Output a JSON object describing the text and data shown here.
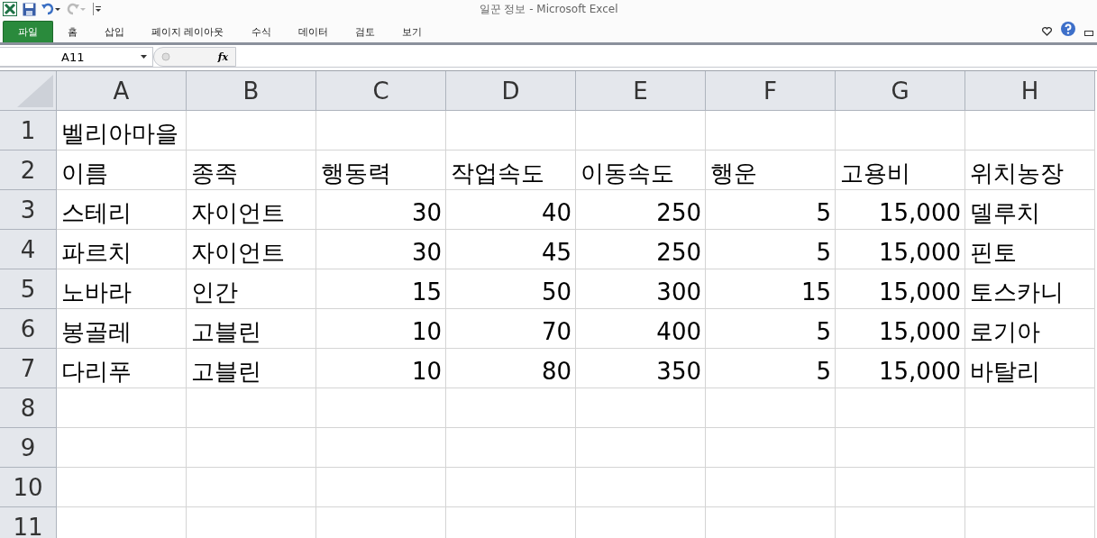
{
  "window": {
    "title": "일꾼 정보  -  Microsoft Excel"
  },
  "ribbon_tabs": [
    {
      "label": "파일",
      "kind": "file",
      "selected": false
    },
    {
      "label": "홈",
      "kind": "tab",
      "selected": false
    },
    {
      "label": "삽입",
      "kind": "tab",
      "selected": false
    },
    {
      "label": "페이지 레이아웃",
      "kind": "tab",
      "selected": false
    },
    {
      "label": "수식",
      "kind": "tab",
      "selected": false
    },
    {
      "label": "데이터",
      "kind": "tab",
      "selected": false
    },
    {
      "label": "검토",
      "kind": "tab",
      "selected": false
    },
    {
      "label": "보기",
      "kind": "tab",
      "selected": false
    }
  ],
  "formula_bar": {
    "name_box": "A11",
    "fx": "fx"
  },
  "sheet": {
    "columns": [
      "A",
      "B",
      "C",
      "D",
      "E",
      "F",
      "G",
      "H"
    ],
    "rows": [
      {
        "header": "1",
        "cells": [
          {
            "text": "벨리아마을",
            "kind": "text"
          },
          null,
          null,
          null,
          null,
          null,
          null,
          null
        ]
      },
      {
        "header": "2",
        "cells": [
          {
            "text": "이름",
            "kind": "text"
          },
          {
            "text": "종족",
            "kind": "text"
          },
          {
            "text": "행동력",
            "kind": "text"
          },
          {
            "text": "작업속도",
            "kind": "text"
          },
          {
            "text": "이동속도",
            "kind": "text"
          },
          {
            "text": "행운",
            "kind": "text"
          },
          {
            "text": "고용비",
            "kind": "text"
          },
          {
            "text": "위치농장",
            "kind": "text"
          }
        ]
      },
      {
        "header": "3",
        "cells": [
          {
            "text": "스테리",
            "kind": "text"
          },
          {
            "text": "자이언트",
            "kind": "text"
          },
          {
            "text": "30",
            "kind": "number"
          },
          {
            "text": "40",
            "kind": "number"
          },
          {
            "text": "250",
            "kind": "number"
          },
          {
            "text": "5",
            "kind": "number"
          },
          {
            "text": "15,000",
            "kind": "number"
          },
          {
            "text": "델루치",
            "kind": "text"
          }
        ]
      },
      {
        "header": "4",
        "cells": [
          {
            "text": "파르치",
            "kind": "text"
          },
          {
            "text": "자이언트",
            "kind": "text"
          },
          {
            "text": "30",
            "kind": "number"
          },
          {
            "text": "45",
            "kind": "number"
          },
          {
            "text": "250",
            "kind": "number"
          },
          {
            "text": "5",
            "kind": "number"
          },
          {
            "text": "15,000",
            "kind": "number"
          },
          {
            "text": "핀토",
            "kind": "text"
          }
        ]
      },
      {
        "header": "5",
        "cells": [
          {
            "text": "노바라",
            "kind": "text"
          },
          {
            "text": "인간",
            "kind": "text"
          },
          {
            "text": "15",
            "kind": "number"
          },
          {
            "text": "50",
            "kind": "number"
          },
          {
            "text": "300",
            "kind": "number"
          },
          {
            "text": "15",
            "kind": "number"
          },
          {
            "text": "15,000",
            "kind": "number"
          },
          {
            "text": "토스카니",
            "kind": "text"
          }
        ]
      },
      {
        "header": "6",
        "cells": [
          {
            "text": "봉골레",
            "kind": "text"
          },
          {
            "text": "고블린",
            "kind": "text"
          },
          {
            "text": "10",
            "kind": "number"
          },
          {
            "text": "70",
            "kind": "number"
          },
          {
            "text": "400",
            "kind": "number"
          },
          {
            "text": "5",
            "kind": "number"
          },
          {
            "text": "15,000",
            "kind": "number"
          },
          {
            "text": "로기아",
            "kind": "text"
          }
        ]
      },
      {
        "header": "7",
        "cells": [
          {
            "text": "다리푸",
            "kind": "text"
          },
          {
            "text": "고블린",
            "kind": "text"
          },
          {
            "text": "10",
            "kind": "number"
          },
          {
            "text": "80",
            "kind": "number"
          },
          {
            "text": "350",
            "kind": "number"
          },
          {
            "text": "5",
            "kind": "number"
          },
          {
            "text": "15,000",
            "kind": "number"
          },
          {
            "text": "바탈리",
            "kind": "text"
          }
        ]
      },
      {
        "header": "8",
        "cells": [
          null,
          null,
          null,
          null,
          null,
          null,
          null,
          null
        ]
      },
      {
        "header": "9",
        "cells": [
          null,
          null,
          null,
          null,
          null,
          null,
          null,
          null
        ]
      },
      {
        "header": "10",
        "cells": [
          null,
          null,
          null,
          null,
          null,
          null,
          null,
          null
        ]
      },
      {
        "header": "11",
        "cells": [
          null,
          null,
          null,
          null,
          null,
          null,
          null,
          null
        ]
      }
    ]
  }
}
